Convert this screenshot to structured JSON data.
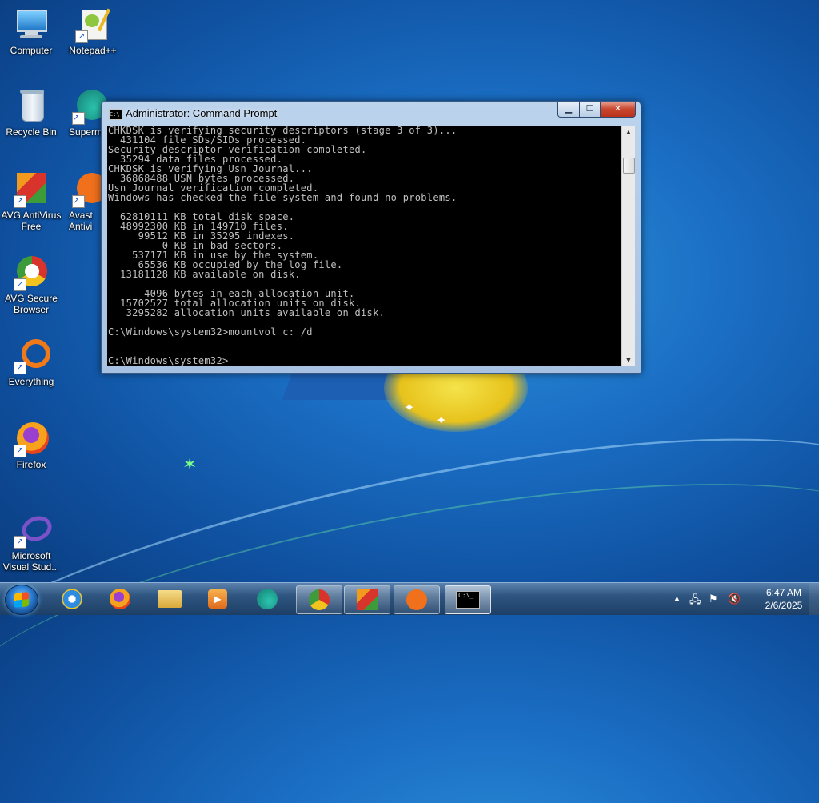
{
  "desktop": {
    "icons": [
      {
        "label": "Computer",
        "icon": "computer-icon"
      },
      {
        "label": "Notepad++",
        "icon": "notepadpp-icon"
      },
      {
        "label": "Recycle Bin",
        "icon": "recycle-bin-icon"
      },
      {
        "label": "Superm",
        "icon": "supermium-icon"
      },
      {
        "label": "AVG AntiVirus Free",
        "icon": "avg-antivirus-icon"
      },
      {
        "label": "Avast Antivi",
        "icon": "avast-icon"
      },
      {
        "label": "AVG Secure Browser",
        "icon": "avg-secure-browser-icon"
      },
      {
        "label": "Everything",
        "icon": "everything-icon"
      },
      {
        "label": "Firefox",
        "icon": "firefox-icon"
      },
      {
        "label": "Microsoft Visual Stud...",
        "icon": "visual-studio-icon"
      }
    ]
  },
  "window": {
    "title": "Administrator: Command Prompt",
    "icon": "cmd-icon",
    "console_text": "CHKDSK is verifying security descriptors (stage 3 of 3)...\n  431104 file SDs/SIDs processed.\nSecurity descriptor verification completed.\n  35294 data files processed.\nCHKDSK is verifying Usn Journal...\n  36868488 USN bytes processed.\nUsn Journal verification completed.\nWindows has checked the file system and found no problems.\n\n  62810111 KB total disk space.\n  48992300 KB in 149710 files.\n     99512 KB in 35295 indexes.\n         0 KB in bad sectors.\n    537171 KB in use by the system.\n     65536 KB occupied by the log file.\n  13181128 KB available on disk.\n\n      4096 bytes in each allocation unit.\n  15702527 total allocation units on disk.\n   3295282 allocation units available on disk.\n\nC:\\Windows\\system32>mountvol c: /d\n\n\nC:\\Windows\\system32>_",
    "buttons": {
      "minimize": "minimize",
      "maximize": "maximize",
      "close": "close"
    }
  },
  "taskbar": {
    "items": [
      {
        "name": "internet-explorer",
        "icon": "internet-explorer-icon",
        "color": "#2f8be0",
        "state": "pinned"
      },
      {
        "name": "firefox",
        "icon": "firefox-icon",
        "color": "#e8641b",
        "state": "pinned"
      },
      {
        "name": "file-explorer",
        "icon": "folder-icon",
        "color": "#e9c45a",
        "state": "pinned"
      },
      {
        "name": "media-player",
        "icon": "media-player-icon",
        "color": "#f08a24",
        "state": "pinned"
      },
      {
        "name": "supermium",
        "icon": "supermium-icon",
        "color": "#1f9a8a",
        "state": "pinned"
      },
      {
        "name": "avg-secure-browser",
        "icon": "avg-secure-browser-icon",
        "color": "#d8342c",
        "state": "open"
      },
      {
        "name": "avg-antivirus",
        "icon": "avg-antivirus-icon",
        "color": "#3f9a3a",
        "state": "open"
      },
      {
        "name": "avast",
        "icon": "avast-icon",
        "color": "#f0701c",
        "state": "open"
      },
      {
        "name": "command-prompt",
        "icon": "cmd-icon",
        "color": "#000000",
        "state": "active"
      }
    ],
    "tray": {
      "time": "6:47 AM",
      "date": "2/6/2025",
      "icons": [
        "show-hidden-icons-chevron",
        "network-icon",
        "action-center-flag-icon",
        "volume-muted-icon"
      ]
    }
  }
}
